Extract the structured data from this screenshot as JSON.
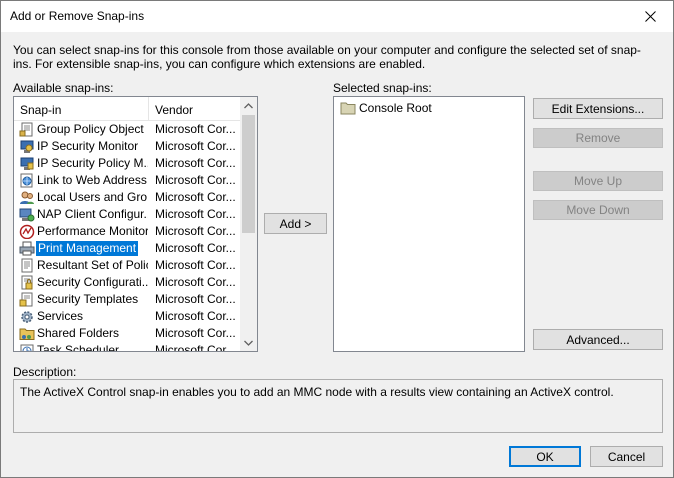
{
  "window": {
    "title": "Add or Remove Snap-ins"
  },
  "intro_text": "You can select snap-ins for this console from those available on your computer and configure the selected set of snap-ins. For extensible snap-ins, you can configure which extensions are enabled.",
  "available": {
    "label": "Available snap-ins:",
    "columns": {
      "snapin": "Snap-in",
      "vendor": "Vendor"
    },
    "items": [
      {
        "name": "Group Policy Object ...",
        "vendor": "Microsoft Cor...",
        "icon": "group-policy-icon"
      },
      {
        "name": "IP Security Monitor",
        "vendor": "Microsoft Cor...",
        "icon": "ip-security-monitor-icon"
      },
      {
        "name": "IP Security Policy M...",
        "vendor": "Microsoft Cor...",
        "icon": "ip-security-policy-icon"
      },
      {
        "name": "Link to Web Address",
        "vendor": "Microsoft Cor...",
        "icon": "link-icon"
      },
      {
        "name": "Local Users and Gro...",
        "vendor": "Microsoft Cor...",
        "icon": "users-icon"
      },
      {
        "name": "NAP Client Configur...",
        "vendor": "Microsoft Cor...",
        "icon": "nap-client-icon"
      },
      {
        "name": "Performance Monitor",
        "vendor": "Microsoft Cor...",
        "icon": "performance-monitor-icon"
      },
      {
        "name": "Print Management",
        "vendor": "Microsoft Cor...",
        "icon": "printer-icon",
        "selected": true
      },
      {
        "name": "Resultant Set of Policy",
        "vendor": "Microsoft Cor...",
        "icon": "policy-document-icon"
      },
      {
        "name": "Security Configurati...",
        "vendor": "Microsoft Cor...",
        "icon": "security-config-icon"
      },
      {
        "name": "Security Templates",
        "vendor": "Microsoft Cor...",
        "icon": "security-templates-icon"
      },
      {
        "name": "Services",
        "vendor": "Microsoft Cor...",
        "icon": "services-gear-icon"
      },
      {
        "name": "Shared Folders",
        "vendor": "Microsoft Cor...",
        "icon": "shared-folders-icon"
      },
      {
        "name": "Task Scheduler",
        "vendor": "Microsoft Cor...",
        "icon": "task-scheduler-icon"
      }
    ]
  },
  "add_button": "Add >",
  "selected": {
    "label": "Selected snap-ins:",
    "items": [
      {
        "name": "Console Root",
        "icon": "folder-icon"
      }
    ]
  },
  "buttons": {
    "edit_extensions": "Edit Extensions...",
    "remove": "Remove",
    "move_up": "Move Up",
    "move_down": "Move Down",
    "advanced": "Advanced...",
    "ok": "OK",
    "cancel": "Cancel"
  },
  "description": {
    "label": "Description:",
    "text": "The ActiveX Control snap-in enables you to add an MMC node with a results view containing an ActiveX control."
  },
  "colors": {
    "selection": "#0078d7",
    "window_bg": "#f0f0f0"
  }
}
